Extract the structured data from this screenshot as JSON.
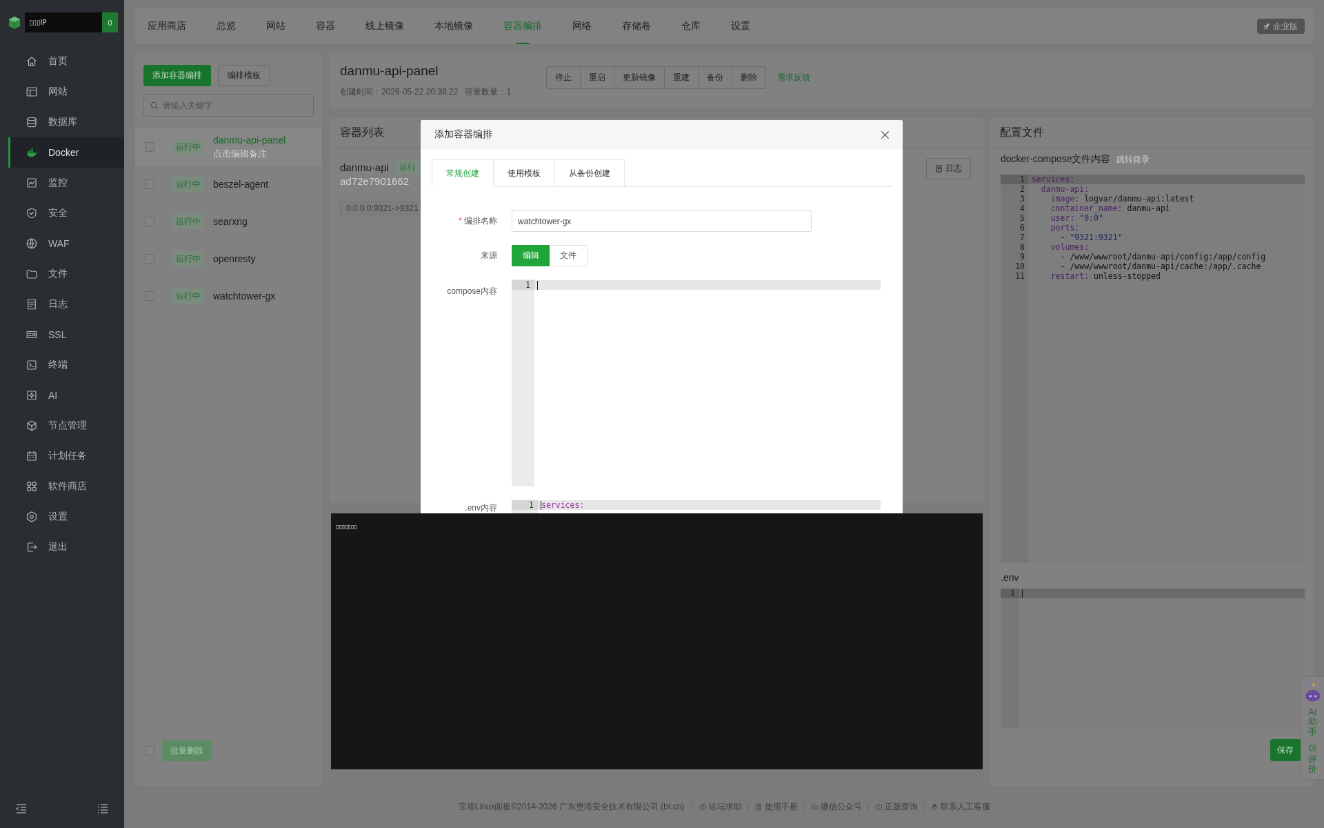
{
  "sidebar": {
    "account": {
      "name": "▯▯▯IP",
      "badge": "0"
    },
    "items": [
      {
        "label": "首页",
        "selected": false
      },
      {
        "label": "网站",
        "selected": false
      },
      {
        "label": "数据库",
        "selected": false
      },
      {
        "label": "Docker",
        "selected": true
      },
      {
        "label": "监控",
        "selected": false
      },
      {
        "label": "安全",
        "selected": false
      },
      {
        "label": "WAF",
        "selected": false
      },
      {
        "label": "文件",
        "selected": false
      },
      {
        "label": "日志",
        "selected": false
      },
      {
        "label": "SSL",
        "selected": false
      },
      {
        "label": "终端",
        "selected": false
      },
      {
        "label": "AI",
        "selected": false
      },
      {
        "label": "节点管理",
        "selected": false
      },
      {
        "label": "计划任务",
        "selected": false
      },
      {
        "label": "软件商店",
        "selected": false
      },
      {
        "label": "设置",
        "selected": false
      },
      {
        "label": "退出",
        "selected": false
      }
    ]
  },
  "top_nav": {
    "tabs": [
      {
        "label": "应用商店",
        "selected": false
      },
      {
        "label": "总览",
        "selected": false
      },
      {
        "label": "网站",
        "selected": false
      },
      {
        "label": "容器",
        "selected": false
      },
      {
        "label": "线上镜像",
        "selected": false
      },
      {
        "label": "本地镜像",
        "selected": false
      },
      {
        "label": "容器编排",
        "selected": true
      },
      {
        "label": "网络",
        "selected": false
      },
      {
        "label": "存储卷",
        "selected": false
      },
      {
        "label": "仓库",
        "selected": false
      },
      {
        "label": "设置",
        "selected": false
      }
    ],
    "edition_badge": "企业版"
  },
  "compose_list": {
    "add_button": "添加容器编排",
    "template_button": "编排模板",
    "search": {
      "placeholder": "请输入关键字"
    },
    "items": [
      {
        "name": "danmu-api-panel",
        "status": "运行中",
        "note": "点击编辑备注",
        "selected": true,
        "checked": false
      },
      {
        "name": "beszel-agent",
        "status": "运行中",
        "selected": false,
        "checked": false
      },
      {
        "name": "searxng",
        "status": "运行中",
        "selected": false,
        "checked": false
      },
      {
        "name": "openresty",
        "status": "运行中",
        "selected": false,
        "checked": false
      },
      {
        "name": "watchtower-gx",
        "status": "运行中",
        "selected": false,
        "checked": false
      }
    ],
    "select_all": {
      "checked": false
    },
    "batch_delete": {
      "label": "批量删除",
      "disabled": true
    }
  },
  "compose_detail": {
    "title": "danmu-api-panel",
    "created": "创建时间：2026-05-22 20:39:22",
    "container_count": "容量数量：1",
    "actions": [
      "停止",
      "重启",
      "更新镜像",
      "重建",
      "备份",
      "删除"
    ],
    "feedback_link": "需求反馈"
  },
  "container_list": {
    "title": "容器列表",
    "containers": [
      {
        "name": "danmu-api",
        "status": "运行",
        "id": "ad72e7901662",
        "port": "0.0.0.0:9321->9321",
        "log_button": "日志"
      }
    ]
  },
  "config": {
    "title": "配置文件",
    "compose_label": "docker-compose文件内容",
    "jump_link": "跳转目录",
    "compose_editor": {
      "lines": [
        {
          "number": "1",
          "highlighted": true,
          "tokens": [
            {
              "kind": "key",
              "text": "services:"
            }
          ]
        },
        {
          "number": "2",
          "highlighted": false,
          "tokens": [
            {
              "kind": "key",
              "text": "  danmu-api:"
            }
          ]
        },
        {
          "number": "3",
          "highlighted": false,
          "tokens": [
            {
              "kind": "key",
              "text": "    image:"
            },
            {
              "kind": "text",
              "text": " logvar/danmu-api:latest"
            }
          ]
        },
        {
          "number": "4",
          "highlighted": false,
          "tokens": [
            {
              "kind": "key",
              "text": "    container_name:"
            },
            {
              "kind": "text",
              "text": " danmu-api"
            }
          ]
        },
        {
          "number": "5",
          "highlighted": false,
          "tokens": [
            {
              "kind": "key",
              "text": "    user:"
            },
            {
              "kind": "string",
              "text": " \"0:0\""
            }
          ]
        },
        {
          "number": "6",
          "highlighted": false,
          "tokens": [
            {
              "kind": "key",
              "text": "    ports:"
            }
          ]
        },
        {
          "number": "7",
          "highlighted": false,
          "tokens": [
            {
              "kind": "text",
              "text": "      - "
            },
            {
              "kind": "string",
              "text": "\"9321:9321\""
            }
          ]
        },
        {
          "number": "8",
          "highlighted": false,
          "tokens": [
            {
              "kind": "key",
              "text": "    volumes:"
            }
          ]
        },
        {
          "number": "9",
          "highlighted": false,
          "tokens": [
            {
              "kind": "text",
              "text": "      - /www/wwwroot/danmu-api/config:/app/config"
            }
          ]
        },
        {
          "number": "10",
          "highlighted": false,
          "tokens": [
            {
              "kind": "text",
              "text": "      - /www/wwwroot/danmu-api/cache:/app/.cache"
            }
          ]
        },
        {
          "number": "11",
          "highlighted": false,
          "tokens": [
            {
              "kind": "key",
              "text": "    restart:"
            },
            {
              "kind": "text",
              "text": " unless-stopped"
            }
          ]
        }
      ]
    },
    "env_label": ".env",
    "env_editor": {
      "cursor": true,
      "lines": [
        {
          "number": "1",
          "highlighted": true
        }
      ]
    },
    "save_button": "保存"
  },
  "modal": {
    "title": "添加容器编排",
    "tabs": [
      {
        "label": "常规创建",
        "selected": true
      },
      {
        "label": "使用模板",
        "selected": false
      },
      {
        "label": "从备份创建",
        "selected": false
      }
    ],
    "name_field": {
      "required_mark": "*",
      "label": "编排名称",
      "value": "watchtower-gx"
    },
    "source": {
      "label": "来源",
      "options": [
        {
          "label": "编辑",
          "selected": true
        },
        {
          "label": "文件",
          "selected": false
        }
      ]
    },
    "compose_label": "compose内容",
    "compose_editor": {
      "cursor": true,
      "lines": [
        {
          "number": "1",
          "highlighted": true
        }
      ]
    },
    "env_label": ".env内容",
    "env_editor": {
      "cursor": true,
      "lines": [
        {
          "number": "1",
          "highlighted": true,
          "tokens": [
            {
              "kind": "key",
              "text": "services:"
            }
          ]
        }
      ]
    }
  },
  "terminal_overlay": {
    "text": "▯▯▯▯▯▯▯"
  },
  "assistant_tab": {
    "title": "AI助手",
    "review": "评价"
  },
  "footer": {
    "copyright": "宝塔Linux面板©2014-2026 广东堡塔安全技术有限公司 (bt.cn)",
    "links": [
      "论坛求助",
      "使用手册",
      "微信公众号",
      "正版查询",
      "联系人工客服"
    ]
  }
}
